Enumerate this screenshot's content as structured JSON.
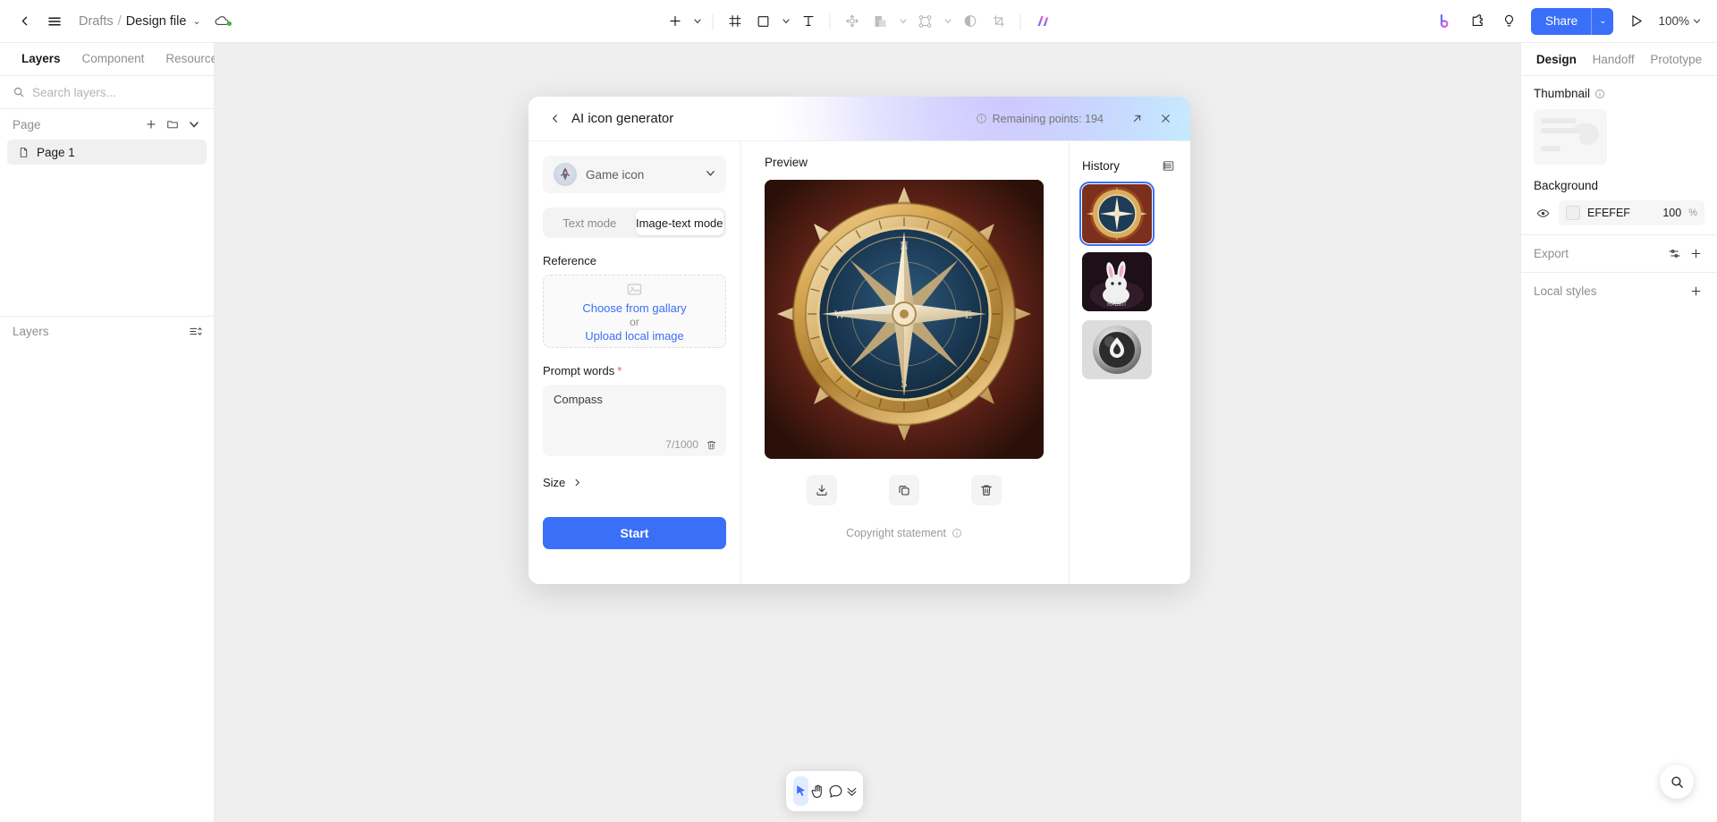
{
  "topbar": {
    "back_icon": "chevron-left-icon",
    "menu_icon": "hamburger-menu-icon",
    "breadcrumb": {
      "root": "Drafts",
      "separator": "/",
      "file": "Design file",
      "caret": "⌄"
    },
    "cloud_icon": "cloud-sync-icon",
    "tools": [
      {
        "name": "add-tool",
        "glyph": "plus",
        "caret": true
      },
      {
        "name": "frame-tool",
        "glyph": "frame",
        "caret": false
      },
      {
        "name": "rectangle-tool",
        "glyph": "square",
        "caret": true
      },
      {
        "name": "text-tool",
        "glyph": "text",
        "caret": false
      },
      {
        "name": "move-tool",
        "glyph": "move",
        "caret": false
      },
      {
        "name": "boolean-tool",
        "glyph": "boolean",
        "caret": true
      },
      {
        "name": "component-tool",
        "glyph": "component",
        "caret": true
      },
      {
        "name": "mask-tool",
        "glyph": "contrast",
        "caret": false
      },
      {
        "name": "slice-tool",
        "glyph": "slice",
        "caret": false
      },
      {
        "name": "ai-tool",
        "glyph": "ai",
        "caret": false
      }
    ],
    "right": {
      "brand_icon": "b-logo-icon",
      "plugin_icon": "plugin-icon",
      "idea_icon": "lightbulb-icon",
      "share_label": "Share",
      "share_caret": "⌄",
      "present_icon": "play-icon",
      "zoom_level": "100%",
      "zoom_caret": "⌄"
    }
  },
  "left_panel": {
    "tabs": [
      {
        "label": "Layers",
        "active": true
      },
      {
        "label": "Component",
        "active": false
      },
      {
        "label": "Resource",
        "active": false
      }
    ],
    "search": {
      "placeholder": "Search layers...",
      "value": "",
      "icon": "search-icon"
    },
    "page_section": {
      "title": "Page",
      "add_icon": "plus-icon",
      "folder_icon": "new-folder-icon",
      "collapse_icon": "chevron-down-icon"
    },
    "pages": [
      {
        "label": "Page 1",
        "icon": "page-icon",
        "selected": true
      }
    ],
    "layers_section": {
      "title": "Layers",
      "sort_icon": "sort-icon"
    }
  },
  "right_panel": {
    "tabs": [
      {
        "label": "Design",
        "active": true
      },
      {
        "label": "Handoff",
        "active": false
      },
      {
        "label": "Prototype",
        "active": false
      }
    ],
    "thumbnail": {
      "label": "Thumbnail",
      "info_icon": "info-icon"
    },
    "background": {
      "label": "Background",
      "visibility_icon": "eye-icon",
      "hex": "EFEFEF",
      "opacity": "100",
      "opacity_unit": "%"
    },
    "export": {
      "label": "Export",
      "settings_icon": "sliders-icon",
      "add_icon": "plus-icon"
    },
    "local_styles": {
      "label": "Local styles",
      "add_icon": "plus-icon"
    }
  },
  "bottom_toolbar": {
    "buttons": [
      {
        "name": "select-tool",
        "icon": "cursor-icon",
        "active": true
      },
      {
        "name": "hand-tool",
        "icon": "hand-icon",
        "active": false
      },
      {
        "name": "comment-tool",
        "icon": "comment-icon",
        "active": false
      },
      {
        "name": "more-tools",
        "icon": "chevrons-down-icon",
        "active": false
      }
    ]
  },
  "search_fab": {
    "icon": "search-icon"
  },
  "modal": {
    "header": {
      "back_icon": "chevron-left-icon",
      "title": "AI icon generator",
      "points_icon": "info-circle-icon",
      "points_text": "Remaining points: 194",
      "expand_icon": "expand-icon",
      "close_icon": "close-icon"
    },
    "model": {
      "name": "Game icon",
      "avatar_icon": "rocket-avatar-icon",
      "caret": "⌄"
    },
    "modes": [
      {
        "label": "Text mode",
        "active": false
      },
      {
        "label": "Image-text mode",
        "active": true
      }
    ],
    "reference": {
      "label": "Reference",
      "image_icon": "image-placeholder-icon",
      "gallery_link": "Choose from gallary",
      "or_text": "or",
      "upload_link": "Upload local image"
    },
    "prompt": {
      "label": "Prompt words",
      "required_mark": "*",
      "value": "Compass",
      "counter": "7/1000",
      "delete_icon": "trash-icon"
    },
    "size": {
      "label": "Size",
      "chevron_icon": "chevron-right-icon"
    },
    "start_button": "Start",
    "preview": {
      "label": "Preview",
      "actions": [
        {
          "name": "download-button",
          "icon": "download-icon"
        },
        {
          "name": "copy-button",
          "icon": "copy-icon"
        },
        {
          "name": "delete-button",
          "icon": "trash-icon"
        }
      ],
      "copyright_text": "Copyright statement",
      "copyright_icon": "info-circle-icon"
    },
    "history": {
      "label": "History",
      "list_icon": "list-view-icon",
      "items": [
        {
          "name": "history-compass",
          "selected": true
        },
        {
          "name": "history-rabbit",
          "selected": false
        },
        {
          "name": "history-flame",
          "selected": false
        }
      ]
    }
  },
  "colors": {
    "accent": "#3a6ff7",
    "canvas": "#efefef",
    "panel_border": "#ececec",
    "required": "#f05a42"
  }
}
